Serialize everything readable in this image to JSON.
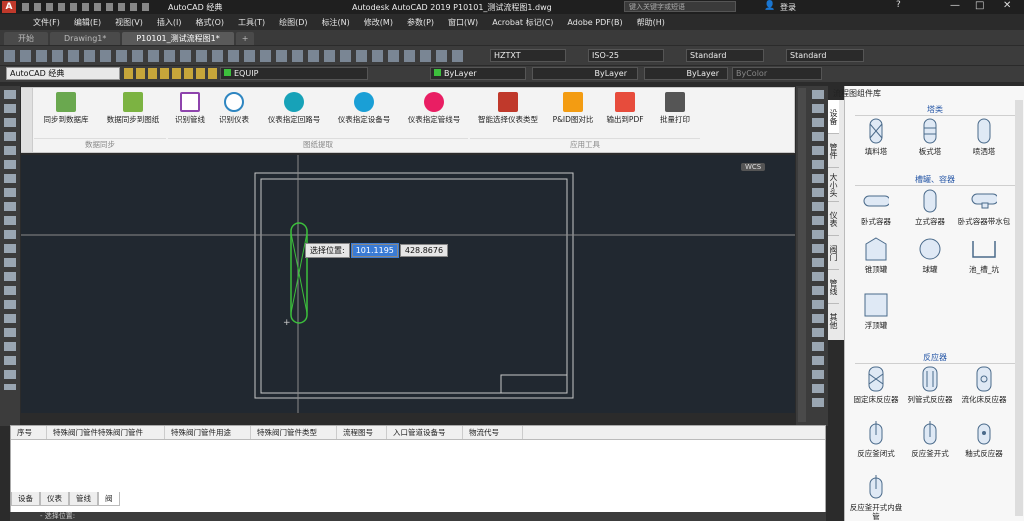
{
  "app": {
    "workspace": "AutoCAD 经典",
    "title": "Autodesk AutoCAD 2019    P10101_测试流程图1.dwg",
    "search_placeholder": "键入关键字或短语",
    "login": "登录"
  },
  "menu": [
    "文件(F)",
    "编辑(E)",
    "视图(V)",
    "插入(I)",
    "格式(O)",
    "工具(T)",
    "绘图(D)",
    "标注(N)",
    "修改(M)",
    "参数(P)",
    "窗口(W)",
    "Acrobat 标记(C)",
    "Adobe PDF(B)",
    "帮助(H)"
  ],
  "tabs": [
    "开始",
    "Drawing1*",
    "P10101_测试流程图1*"
  ],
  "toolbar": {
    "text_style": "HZTXT",
    "dim_style": "ISO-25",
    "table_style": "Standard",
    "multileader_style": "Standard"
  },
  "props": {
    "workspace_combo": "AutoCAD 经典",
    "layer": "EQUIP",
    "color": "ByLayer",
    "linetype": "ByLayer",
    "lineweight": "ByLayer",
    "plotstyle": "ByColor"
  },
  "ribbon": {
    "buttons": [
      {
        "label": "同步到数据库",
        "color": "#6aa84f"
      },
      {
        "label": "数据同步到图纸",
        "color": "#7cb342"
      },
      {
        "label": "识别管线",
        "color": "#8e44ad"
      },
      {
        "label": "识别仪表",
        "color": "#2e86c1"
      },
      {
        "label": "仪表指定回路号",
        "color": "#17a2b8"
      },
      {
        "label": "仪表指定设备号",
        "color": "#1a9fd6"
      },
      {
        "label": "仪表指定管线号",
        "color": "#e91e63"
      },
      {
        "label": "智能选择仪表类型",
        "color": "#c0392b"
      },
      {
        "label": "P&ID图对比",
        "color": "#f39c12"
      },
      {
        "label": "输出到PDF",
        "color": "#e74c3c"
      },
      {
        "label": "批量打印",
        "color": "#555555"
      }
    ],
    "groups": [
      "数据同步",
      "图纸提取",
      "应用工具"
    ]
  },
  "canvas": {
    "wcs": "WCS",
    "prompt": "选择位置:",
    "x_value": "101.1195",
    "y_value": "428.8676"
  },
  "panel": {
    "title": "流程图组件库",
    "side_tabs": [
      "设备",
      "管件",
      "大小头",
      "仪表",
      "阀门",
      "管线",
      "其他"
    ],
    "sections": [
      {
        "name": "塔类",
        "items": [
          "填料塔",
          "板式塔",
          "喷洒塔"
        ]
      },
      {
        "name": "槽罐、容器",
        "items": [
          "卧式容器",
          "立式容器",
          "卧式容器带水包",
          "锥顶罐",
          "球罐",
          "池_槽_坑",
          "浮顶罐"
        ]
      },
      {
        "name": "反应器",
        "items": [
          "固定床反应器",
          "列管式反应器",
          "流化床反应器",
          "反应釜闭式",
          "反应釜开式",
          "釉式反应器",
          "反应釜开式内盘管"
        ]
      }
    ]
  },
  "grid": {
    "columns": [
      "序号",
      "特殊阀门管件特殊阀门管件",
      "特殊阀门管件用途",
      "特殊阀门管件类型",
      "流程图号",
      "入口管道设备号",
      "物流代号"
    ],
    "bottom_tabs": [
      "设备",
      "仪表",
      "管线",
      "阀"
    ]
  },
  "command": "- 选择位置:"
}
